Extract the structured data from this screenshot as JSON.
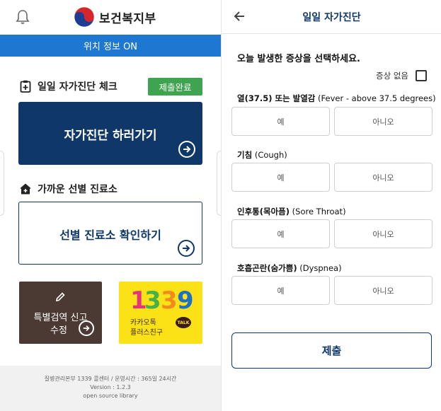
{
  "left": {
    "header": {
      "logo_text": "보건복지부"
    },
    "location_bar": "위치 정보 ON",
    "self_check": {
      "section_title": "일일 자가진단 체크",
      "badge": "제출완료",
      "button_label": "자가진단 하러가기"
    },
    "clinic": {
      "section_title": "가까운 선별 진료소",
      "button_label": "선별 진료소 확인하기"
    },
    "report": {
      "line1": "특별검역 신고",
      "line2": "수정"
    },
    "kakao": {
      "number": "1339",
      "line1": "카카오톡",
      "line2": "플러스친구",
      "talk": "TALK"
    },
    "footer": {
      "line1": "질병관리본부 1339 콜센터 / 운영시간 : 365일 24시간",
      "line2": "Version : 1.2.3",
      "line3": "open source library"
    }
  },
  "right": {
    "header": {
      "title": "일일 자가진단"
    },
    "prompt": "오늘 발생한 증상을 선택하세요.",
    "no_symptom_label": "증상 없음",
    "questions": [
      {
        "label_bold": "열(37.5) 또는 발열감",
        "label_rest": " (Fever - above 37.5 degrees)",
        "yes": "예",
        "no": "아니오"
      },
      {
        "label_bold": "기침",
        "label_rest": " (Cough)",
        "yes": "예",
        "no": "아니오"
      },
      {
        "label_bold": "인후통(목아픔)",
        "label_rest": " (Sore Throat)",
        "yes": "예",
        "no": "아니오"
      },
      {
        "label_bold": "호흡곤란(숨가쁨)",
        "label_rest": " (Dyspnea)",
        "yes": "예",
        "no": "아니오"
      }
    ],
    "submit_label": "제출"
  },
  "colors": {
    "navy": "#0f3869",
    "location_bar": "#1e77d0",
    "badge_green": "#3fa450",
    "report_brown": "#4a3a33",
    "kakao_yellow": "#fbe216"
  },
  "icons": {
    "bell": "bell-icon",
    "clipboard": "clipboard-plus-icon",
    "house": "house-plus-icon",
    "arrow": "arrow-right-circle-icon",
    "pencil": "pencil-icon",
    "back": "arrow-left-icon"
  }
}
